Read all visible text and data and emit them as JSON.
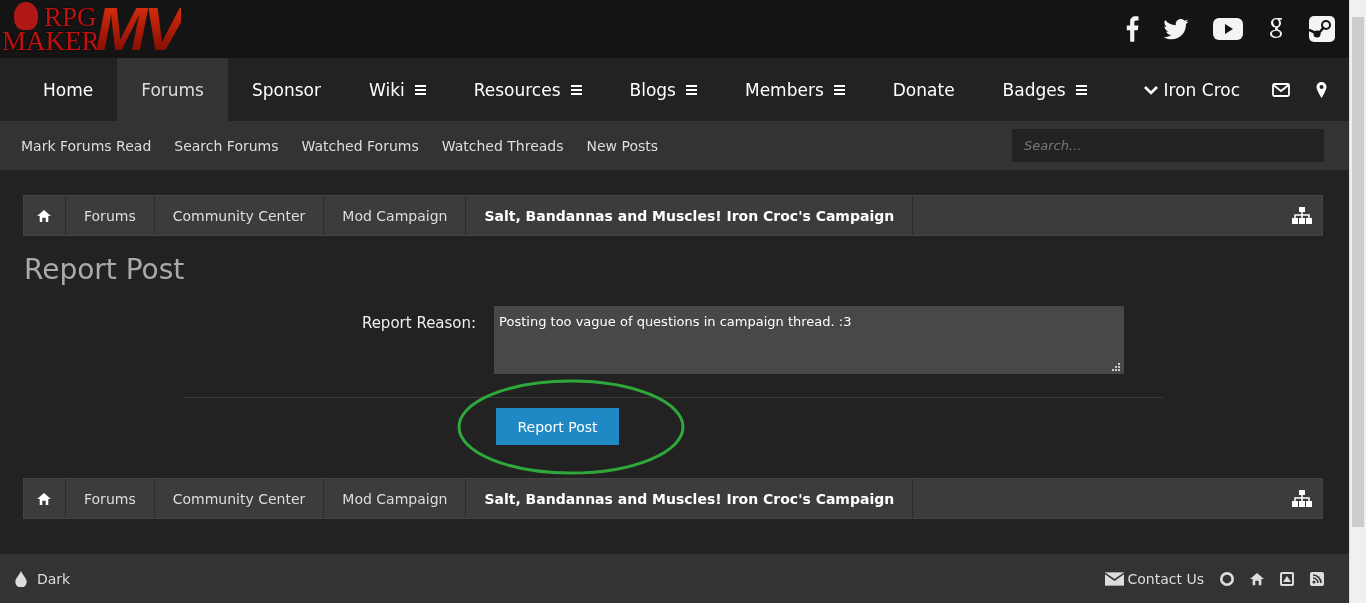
{
  "logo": {
    "line1": "RPG",
    "line2": "MAKER",
    "mark": "MV"
  },
  "nav": {
    "items": [
      {
        "label": "Home",
        "selected": false,
        "has_menu": false
      },
      {
        "label": "Forums",
        "selected": true,
        "has_menu": false
      },
      {
        "label": "Sponsor",
        "selected": false,
        "has_menu": false
      },
      {
        "label": "Wiki",
        "selected": false,
        "has_menu": true
      },
      {
        "label": "Resources",
        "selected": false,
        "has_menu": true
      },
      {
        "label": "Blogs",
        "selected": false,
        "has_menu": true
      },
      {
        "label": "Members",
        "selected": false,
        "has_menu": true
      },
      {
        "label": "Donate",
        "selected": false,
        "has_menu": false
      },
      {
        "label": "Badges",
        "selected": false,
        "has_menu": true
      }
    ],
    "user": "Iron Croc"
  },
  "subnav": {
    "links": [
      "Mark Forums Read",
      "Search Forums",
      "Watched Forums",
      "Watched Threads",
      "New Posts"
    ],
    "search": {
      "placeholder": "Search..."
    }
  },
  "breadcrumbs_top": [
    "Forums",
    "Community Center",
    "Mod Campaign",
    "Salt, Bandannas and Muscles! Iron Croc's Campaign"
  ],
  "title": "Report Post",
  "form": {
    "label": "Report Reason:",
    "value": "Posting too vague of questions in campaign thread. :3",
    "button": "Report Post",
    "annotated": true
  },
  "breadcrumbs_bottom": [
    "Forums",
    "Community Center",
    "Mod Campaign",
    "Salt, Bandannas and Muscles! Iron Croc's Campaign"
  ],
  "footer": {
    "style": "Dark",
    "contact": "Contact Us"
  }
}
